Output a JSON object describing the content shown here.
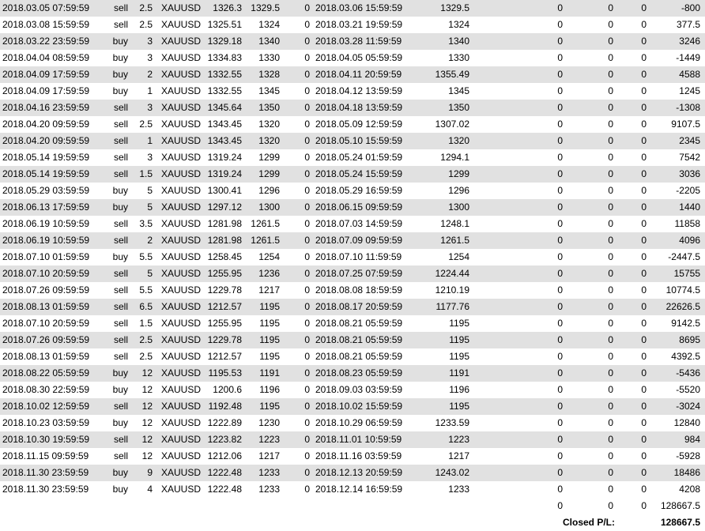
{
  "trades": [
    {
      "open_time": "2018.03.05 07:59:59",
      "type": "sell",
      "size": "2.5",
      "item": "XAUUSD",
      "open_price": "1326.3",
      "sl": "1329.5",
      "tp": "0",
      "close_time": "2018.03.06 15:59:59",
      "close_price": "1329.5",
      "commission": "0",
      "taxes": "0",
      "swap": "0",
      "profit": "-800"
    },
    {
      "open_time": "2018.03.08 15:59:59",
      "type": "sell",
      "size": "2.5",
      "item": "XAUUSD",
      "open_price": "1325.51",
      "sl": "1324",
      "tp": "0",
      "close_time": "2018.03.21 19:59:59",
      "close_price": "1324",
      "commission": "0",
      "taxes": "0",
      "swap": "0",
      "profit": "377.5"
    },
    {
      "open_time": "2018.03.22 23:59:59",
      "type": "buy",
      "size": "3",
      "item": "XAUUSD",
      "open_price": "1329.18",
      "sl": "1340",
      "tp": "0",
      "close_time": "2018.03.28 11:59:59",
      "close_price": "1340",
      "commission": "0",
      "taxes": "0",
      "swap": "0",
      "profit": "3246"
    },
    {
      "open_time": "2018.04.04 08:59:59",
      "type": "buy",
      "size": "3",
      "item": "XAUUSD",
      "open_price": "1334.83",
      "sl": "1330",
      "tp": "0",
      "close_time": "2018.04.05 05:59:59",
      "close_price": "1330",
      "commission": "0",
      "taxes": "0",
      "swap": "0",
      "profit": "-1449"
    },
    {
      "open_time": "2018.04.09 17:59:59",
      "type": "buy",
      "size": "2",
      "item": "XAUUSD",
      "open_price": "1332.55",
      "sl": "1328",
      "tp": "0",
      "close_time": "2018.04.11 20:59:59",
      "close_price": "1355.49",
      "commission": "0",
      "taxes": "0",
      "swap": "0",
      "profit": "4588"
    },
    {
      "open_time": "2018.04.09 17:59:59",
      "type": "buy",
      "size": "1",
      "item": "XAUUSD",
      "open_price": "1332.55",
      "sl": "1345",
      "tp": "0",
      "close_time": "2018.04.12 13:59:59",
      "close_price": "1345",
      "commission": "0",
      "taxes": "0",
      "swap": "0",
      "profit": "1245"
    },
    {
      "open_time": "2018.04.16 23:59:59",
      "type": "sell",
      "size": "3",
      "item": "XAUUSD",
      "open_price": "1345.64",
      "sl": "1350",
      "tp": "0",
      "close_time": "2018.04.18 13:59:59",
      "close_price": "1350",
      "commission": "0",
      "taxes": "0",
      "swap": "0",
      "profit": "-1308"
    },
    {
      "open_time": "2018.04.20 09:59:59",
      "type": "sell",
      "size": "2.5",
      "item": "XAUUSD",
      "open_price": "1343.45",
      "sl": "1320",
      "tp": "0",
      "close_time": "2018.05.09 12:59:59",
      "close_price": "1307.02",
      "commission": "0",
      "taxes": "0",
      "swap": "0",
      "profit": "9107.5"
    },
    {
      "open_time": "2018.04.20 09:59:59",
      "type": "sell",
      "size": "1",
      "item": "XAUUSD",
      "open_price": "1343.45",
      "sl": "1320",
      "tp": "0",
      "close_time": "2018.05.10 15:59:59",
      "close_price": "1320",
      "commission": "0",
      "taxes": "0",
      "swap": "0",
      "profit": "2345"
    },
    {
      "open_time": "2018.05.14 19:59:59",
      "type": "sell",
      "size": "3",
      "item": "XAUUSD",
      "open_price": "1319.24",
      "sl": "1299",
      "tp": "0",
      "close_time": "2018.05.24 01:59:59",
      "close_price": "1294.1",
      "commission": "0",
      "taxes": "0",
      "swap": "0",
      "profit": "7542"
    },
    {
      "open_time": "2018.05.14 19:59:59",
      "type": "sell",
      "size": "1.5",
      "item": "XAUUSD",
      "open_price": "1319.24",
      "sl": "1299",
      "tp": "0",
      "close_time": "2018.05.24 15:59:59",
      "close_price": "1299",
      "commission": "0",
      "taxes": "0",
      "swap": "0",
      "profit": "3036"
    },
    {
      "open_time": "2018.05.29 03:59:59",
      "type": "buy",
      "size": "5",
      "item": "XAUUSD",
      "open_price": "1300.41",
      "sl": "1296",
      "tp": "0",
      "close_time": "2018.05.29 16:59:59",
      "close_price": "1296",
      "commission": "0",
      "taxes": "0",
      "swap": "0",
      "profit": "-2205"
    },
    {
      "open_time": "2018.06.13 17:59:59",
      "type": "buy",
      "size": "5",
      "item": "XAUUSD",
      "open_price": "1297.12",
      "sl": "1300",
      "tp": "0",
      "close_time": "2018.06.15 09:59:59",
      "close_price": "1300",
      "commission": "0",
      "taxes": "0",
      "swap": "0",
      "profit": "1440"
    },
    {
      "open_time": "2018.06.19 10:59:59",
      "type": "sell",
      "size": "3.5",
      "item": "XAUUSD",
      "open_price": "1281.98",
      "sl": "1261.5",
      "tp": "0",
      "close_time": "2018.07.03 14:59:59",
      "close_price": "1248.1",
      "commission": "0",
      "taxes": "0",
      "swap": "0",
      "profit": "11858"
    },
    {
      "open_time": "2018.06.19 10:59:59",
      "type": "sell",
      "size": "2",
      "item": "XAUUSD",
      "open_price": "1281.98",
      "sl": "1261.5",
      "tp": "0",
      "close_time": "2018.07.09 09:59:59",
      "close_price": "1261.5",
      "commission": "0",
      "taxes": "0",
      "swap": "0",
      "profit": "4096"
    },
    {
      "open_time": "2018.07.10 01:59:59",
      "type": "buy",
      "size": "5.5",
      "item": "XAUUSD",
      "open_price": "1258.45",
      "sl": "1254",
      "tp": "0",
      "close_time": "2018.07.10 11:59:59",
      "close_price": "1254",
      "commission": "0",
      "taxes": "0",
      "swap": "0",
      "profit": "-2447.5"
    },
    {
      "open_time": "2018.07.10 20:59:59",
      "type": "sell",
      "size": "5",
      "item": "XAUUSD",
      "open_price": "1255.95",
      "sl": "1236",
      "tp": "0",
      "close_time": "2018.07.25 07:59:59",
      "close_price": "1224.44",
      "commission": "0",
      "taxes": "0",
      "swap": "0",
      "profit": "15755"
    },
    {
      "open_time": "2018.07.26 09:59:59",
      "type": "sell",
      "size": "5.5",
      "item": "XAUUSD",
      "open_price": "1229.78",
      "sl": "1217",
      "tp": "0",
      "close_time": "2018.08.08 18:59:59",
      "close_price": "1210.19",
      "commission": "0",
      "taxes": "0",
      "swap": "0",
      "profit": "10774.5"
    },
    {
      "open_time": "2018.08.13 01:59:59",
      "type": "sell",
      "size": "6.5",
      "item": "XAUUSD",
      "open_price": "1212.57",
      "sl": "1195",
      "tp": "0",
      "close_time": "2018.08.17 20:59:59",
      "close_price": "1177.76",
      "commission": "0",
      "taxes": "0",
      "swap": "0",
      "profit": "22626.5"
    },
    {
      "open_time": "2018.07.10 20:59:59",
      "type": "sell",
      "size": "1.5",
      "item": "XAUUSD",
      "open_price": "1255.95",
      "sl": "1195",
      "tp": "0",
      "close_time": "2018.08.21 05:59:59",
      "close_price": "1195",
      "commission": "0",
      "taxes": "0",
      "swap": "0",
      "profit": "9142.5"
    },
    {
      "open_time": "2018.07.26 09:59:59",
      "type": "sell",
      "size": "2.5",
      "item": "XAUUSD",
      "open_price": "1229.78",
      "sl": "1195",
      "tp": "0",
      "close_time": "2018.08.21 05:59:59",
      "close_price": "1195",
      "commission": "0",
      "taxes": "0",
      "swap": "0",
      "profit": "8695"
    },
    {
      "open_time": "2018.08.13 01:59:59",
      "type": "sell",
      "size": "2.5",
      "item": "XAUUSD",
      "open_price": "1212.57",
      "sl": "1195",
      "tp": "0",
      "close_time": "2018.08.21 05:59:59",
      "close_price": "1195",
      "commission": "0",
      "taxes": "0",
      "swap": "0",
      "profit": "4392.5"
    },
    {
      "open_time": "2018.08.22 05:59:59",
      "type": "buy",
      "size": "12",
      "item": "XAUUSD",
      "open_price": "1195.53",
      "sl": "1191",
      "tp": "0",
      "close_time": "2018.08.23 05:59:59",
      "close_price": "1191",
      "commission": "0",
      "taxes": "0",
      "swap": "0",
      "profit": "-5436"
    },
    {
      "open_time": "2018.08.30 22:59:59",
      "type": "buy",
      "size": "12",
      "item": "XAUUSD",
      "open_price": "1200.6",
      "sl": "1196",
      "tp": "0",
      "close_time": "2018.09.03 03:59:59",
      "close_price": "1196",
      "commission": "0",
      "taxes": "0",
      "swap": "0",
      "profit": "-5520"
    },
    {
      "open_time": "2018.10.02 12:59:59",
      "type": "sell",
      "size": "12",
      "item": "XAUUSD",
      "open_price": "1192.48",
      "sl": "1195",
      "tp": "0",
      "close_time": "2018.10.02 15:59:59",
      "close_price": "1195",
      "commission": "0",
      "taxes": "0",
      "swap": "0",
      "profit": "-3024"
    },
    {
      "open_time": "2018.10.23 03:59:59",
      "type": "buy",
      "size": "12",
      "item": "XAUUSD",
      "open_price": "1222.89",
      "sl": "1230",
      "tp": "0",
      "close_time": "2018.10.29 06:59:59",
      "close_price": "1233.59",
      "commission": "0",
      "taxes": "0",
      "swap": "0",
      "profit": "12840"
    },
    {
      "open_time": "2018.10.30 19:59:59",
      "type": "sell",
      "size": "12",
      "item": "XAUUSD",
      "open_price": "1223.82",
      "sl": "1223",
      "tp": "0",
      "close_time": "2018.11.01 10:59:59",
      "close_price": "1223",
      "commission": "0",
      "taxes": "0",
      "swap": "0",
      "profit": "984"
    },
    {
      "open_time": "2018.11.15 09:59:59",
      "type": "sell",
      "size": "12",
      "item": "XAUUSD",
      "open_price": "1212.06",
      "sl": "1217",
      "tp": "0",
      "close_time": "2018.11.16 03:59:59",
      "close_price": "1217",
      "commission": "0",
      "taxes": "0",
      "swap": "0",
      "profit": "-5928"
    },
    {
      "open_time": "2018.11.30 23:59:59",
      "type": "buy",
      "size": "9",
      "item": "XAUUSD",
      "open_price": "1222.48",
      "sl": "1233",
      "tp": "0",
      "close_time": "2018.12.13 20:59:59",
      "close_price": "1243.02",
      "commission": "0",
      "taxes": "0",
      "swap": "0",
      "profit": "18486"
    },
    {
      "open_time": "2018.11.30 23:59:59",
      "type": "buy",
      "size": "4",
      "item": "XAUUSD",
      "open_price": "1222.48",
      "sl": "1233",
      "tp": "0",
      "close_time": "2018.12.14 16:59:59",
      "close_price": "1233",
      "commission": "0",
      "taxes": "0",
      "swap": "0",
      "profit": "4208"
    }
  ],
  "totals": {
    "commission": "0",
    "taxes": "0",
    "swap": "0",
    "profit": "128667.5"
  },
  "summary": {
    "label": "Closed P/L:",
    "value": "128667.5"
  },
  "colors": {
    "alt_row": "#e1e1e1",
    "plain_row": "#ffffff",
    "text": "#000000"
  }
}
